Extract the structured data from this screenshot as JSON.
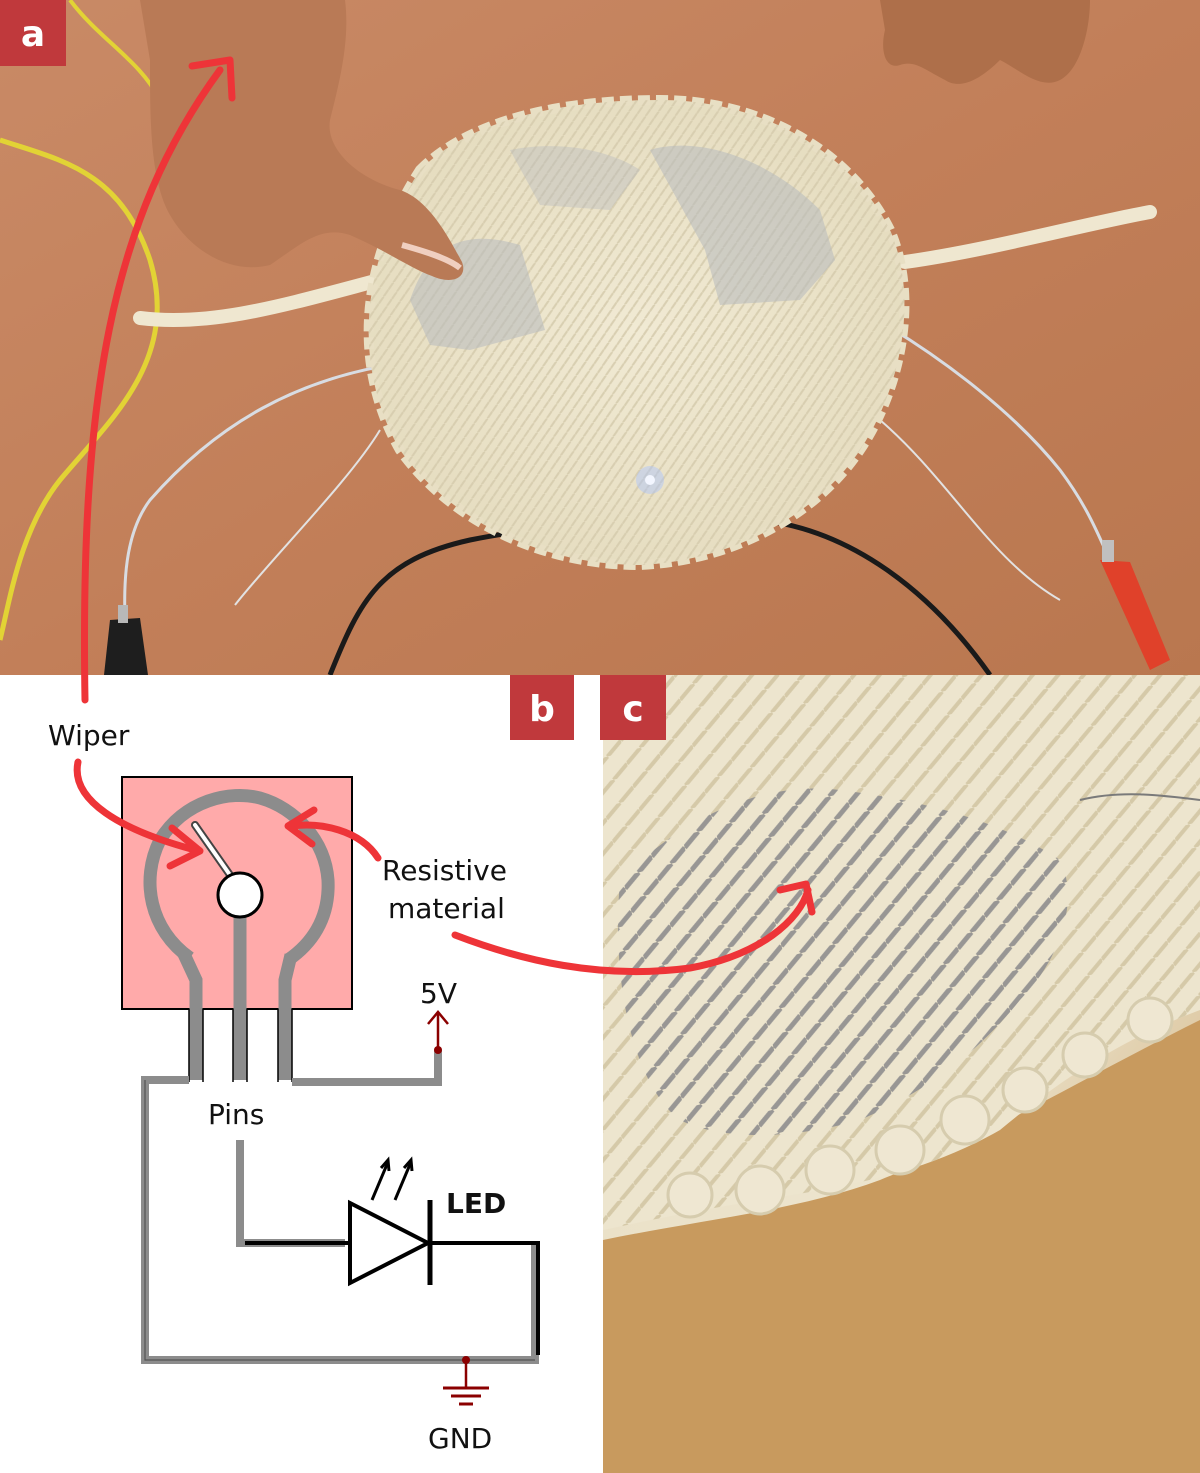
{
  "panels": {
    "a": {
      "badge": "a"
    },
    "b": {
      "badge": "b"
    },
    "c": {
      "badge": "c"
    }
  },
  "labels": {
    "wiper": "Wiper",
    "resistive_line1": "Resistive",
    "resistive_line2": "material",
    "pins": "Pins",
    "led": "LED",
    "five_v": "5V",
    "gnd": "GND"
  },
  "colors": {
    "badge": "#c0393c",
    "arrow": "#ee3438",
    "pot_body": "#ffaaaa",
    "trace": "#888888",
    "wire": "#000000",
    "supply": "#8b0000",
    "background_photo": "#c8865f",
    "fabric": "#ede6cf"
  }
}
